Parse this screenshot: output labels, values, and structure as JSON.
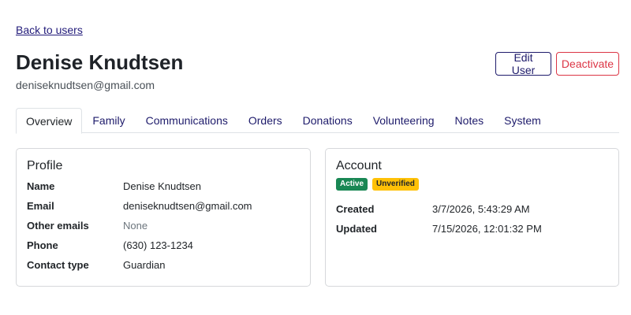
{
  "back_link": "Back to users",
  "user": {
    "name": "Denise Knudtsen",
    "email": "deniseknudtsen@gmail.com"
  },
  "actions": {
    "edit_label": "Edit User",
    "deactivate_label": "Deactivate"
  },
  "tabs": [
    {
      "label": "Overview",
      "active": true
    },
    {
      "label": "Family"
    },
    {
      "label": "Communications"
    },
    {
      "label": "Orders"
    },
    {
      "label": "Donations"
    },
    {
      "label": "Volunteering"
    },
    {
      "label": "Notes"
    },
    {
      "label": "System"
    }
  ],
  "profile": {
    "title": "Profile",
    "rows": [
      {
        "label": "Name",
        "value": "Denise Knudtsen"
      },
      {
        "label": "Email",
        "value": "deniseknudtsen@gmail.com"
      },
      {
        "label": "Other emails",
        "value": "None"
      },
      {
        "label": "Phone",
        "value": "(630) 123-1234"
      },
      {
        "label": "Contact type",
        "value": "Guardian"
      }
    ]
  },
  "account": {
    "title": "Account",
    "badges": [
      {
        "label": "Active",
        "color": "#198754"
      },
      {
        "label": "Unverified",
        "color": "#ffc107"
      }
    ],
    "rows": [
      {
        "label": "Created",
        "value": "3/7/2026, 5:43:29 AM"
      },
      {
        "label": "Updated",
        "value": "7/15/2026, 12:01:32 PM"
      }
    ]
  }
}
